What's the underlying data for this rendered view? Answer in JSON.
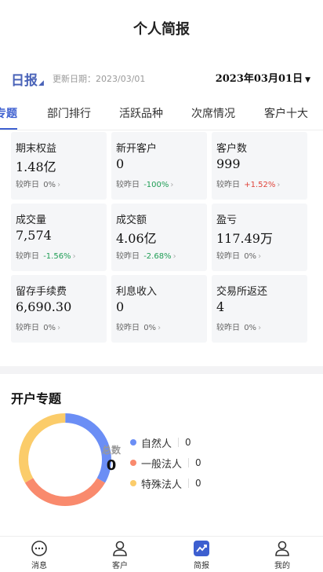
{
  "header": {
    "title": "个人简报"
  },
  "report": {
    "type_label": "日报",
    "update_label": "更新日期：2023/03/01",
    "selected_date": "2023年03月01日"
  },
  "tabs": [
    {
      "label": "专题",
      "active": true
    },
    {
      "label": "部门排行",
      "active": false
    },
    {
      "label": "活跃品种",
      "active": false
    },
    {
      "label": "次席情况",
      "active": false
    },
    {
      "label": "客户十大",
      "active": false
    }
  ],
  "metrics": [
    {
      "label": "期末权益",
      "value": "1.48亿",
      "compare_label": "较昨日",
      "delta": "0%",
      "trend": "flat"
    },
    {
      "label": "新开客户",
      "value": "0",
      "compare_label": "较昨日",
      "delta": "-100%",
      "trend": "down"
    },
    {
      "label": "客户数",
      "value": "999",
      "compare_label": "较昨日",
      "delta": "+1.52%",
      "trend": "up"
    },
    {
      "label": "成交量",
      "value": "7,574",
      "compare_label": "较昨日",
      "delta": "-1.56%",
      "trend": "down"
    },
    {
      "label": "成交额",
      "value": "4.06亿",
      "compare_label": "较昨日",
      "delta": "-2.68%",
      "trend": "down"
    },
    {
      "label": "盈亏",
      "value": "117.49万",
      "compare_label": "较昨日",
      "delta": "0%",
      "trend": "flat"
    },
    {
      "label": "留存手续费",
      "value": "6,690.30",
      "compare_label": "较昨日",
      "delta": "0%",
      "trend": "flat"
    },
    {
      "label": "利息收入",
      "value": "0",
      "compare_label": "较昨日",
      "delta": "0%",
      "trend": "flat"
    },
    {
      "label": "交易所返还",
      "value": "4",
      "compare_label": "较昨日",
      "delta": "0%",
      "trend": "flat"
    }
  ],
  "account_section": {
    "title": "开户专题",
    "total_label": "总数",
    "total_value": "0",
    "legend": [
      {
        "label": "自然人",
        "count": "0",
        "color": "#6b8ef5"
      },
      {
        "label": "一般法人",
        "count": "0",
        "color": "#f98a6d"
      },
      {
        "label": "特殊法人",
        "count": "0",
        "color": "#fbcc6a"
      }
    ]
  },
  "bottom_nav": [
    {
      "label": "消息",
      "icon": "chat-bubble-icon",
      "active": false
    },
    {
      "label": "客户",
      "icon": "person-icon",
      "active": false
    },
    {
      "label": "简报",
      "icon": "trend-chart-icon",
      "active": true
    },
    {
      "label": "我的",
      "icon": "user-profile-icon",
      "active": false
    }
  ],
  "colors": {
    "accent": "#3d5fd0",
    "report_label": "#4a63b8",
    "up": "#e0433a",
    "down": "#1f9d55"
  }
}
